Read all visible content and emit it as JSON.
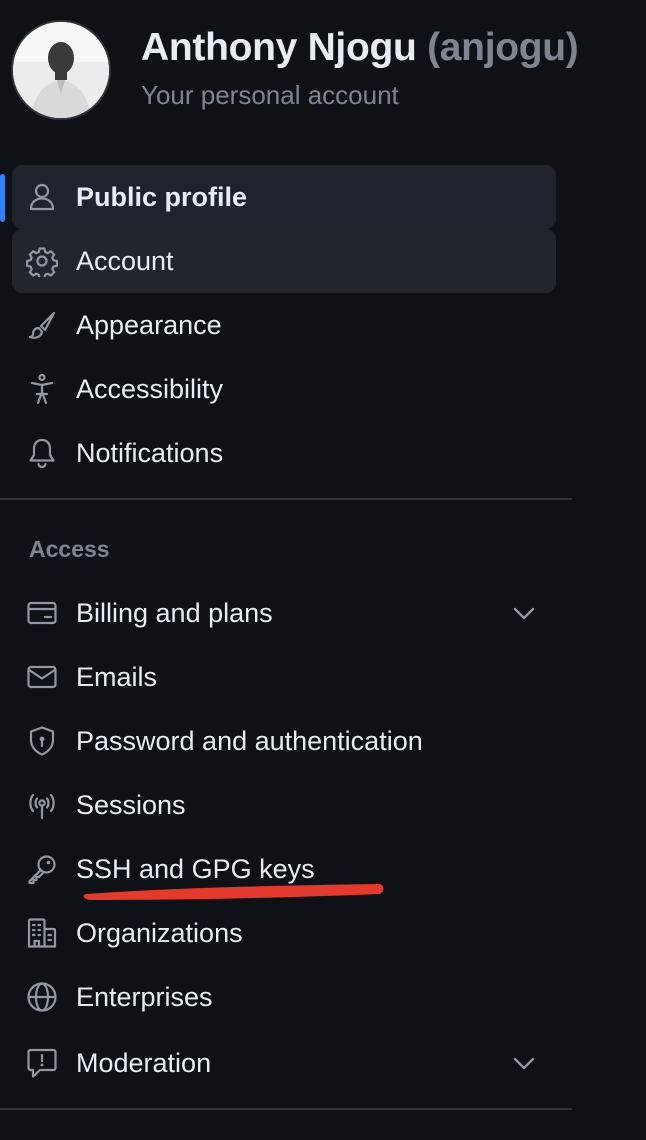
{
  "header": {
    "name": "Anthony Njogu",
    "login": "(anjogu)",
    "subtitle": "Your personal account"
  },
  "nav": {
    "items": [
      {
        "label": "Public profile",
        "icon": "person-icon",
        "state": "selected"
      },
      {
        "label": "Account",
        "icon": "gear-icon",
        "state": "hover"
      },
      {
        "label": "Appearance",
        "icon": "paintbrush-icon"
      },
      {
        "label": "Accessibility",
        "icon": "accessibility-icon"
      },
      {
        "label": "Notifications",
        "icon": "bell-icon"
      }
    ]
  },
  "access": {
    "title": "Access",
    "items": [
      {
        "label": "Billing and plans",
        "icon": "credit-card-icon",
        "expandable": true
      },
      {
        "label": "Emails",
        "icon": "mail-icon"
      },
      {
        "label": "Password and authentication",
        "icon": "shield-lock-icon"
      },
      {
        "label": "Sessions",
        "icon": "broadcast-icon"
      },
      {
        "label": "SSH and GPG keys",
        "icon": "key-icon",
        "highlighted": true
      },
      {
        "label": "Organizations",
        "icon": "organization-icon"
      },
      {
        "label": "Enterprises",
        "icon": "globe-icon"
      },
      {
        "label": "Moderation",
        "icon": "report-icon",
        "expandable": true
      }
    ]
  },
  "colors": {
    "background": "#0e1116",
    "selected_bg": "#1f242c",
    "accent_bar": "#2f81f7",
    "muted_text": "#7d8590",
    "annotation": "#e5392b"
  }
}
